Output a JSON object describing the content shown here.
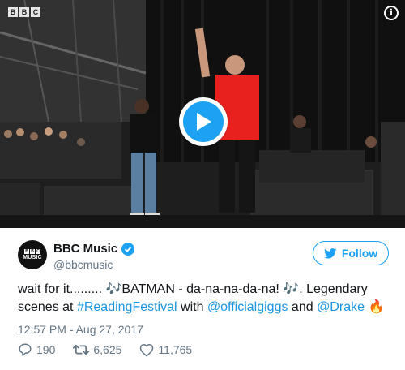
{
  "media": {
    "broadcaster_logo_letters": [
      "B",
      "B",
      "C"
    ],
    "info_label": "i"
  },
  "author": {
    "display_name": "BBC Music",
    "handle": "@bbcmusic",
    "avatar_letters": [
      "B",
      "B",
      "C"
    ],
    "avatar_word": "MUSIC",
    "verified": true
  },
  "follow_label": "Follow",
  "tweet": {
    "part1": "wait for it......... ",
    "notes1": "🎶",
    "part2": "BATMAN - da-na-na-da-na! ",
    "notes2": "🎶",
    "part3": ". Legendary scenes at ",
    "hashtag": "#ReadingFestival",
    "part4": " with ",
    "mention1": "@officialgiggs",
    "part5": " and ",
    "mention2": "@Drake",
    "part6": " ",
    "fire": "🔥"
  },
  "timestamp": "12:57 PM - Aug 27, 2017",
  "stats": {
    "replies": "190",
    "retweets": "6,625",
    "likes": "11,765"
  },
  "colors": {
    "accent": "#1da1f2",
    "link": "#1b95e0",
    "muted": "#657786",
    "shirt_red": "#e8201e"
  },
  "icons": [
    "play-icon",
    "info-icon",
    "verified-badge-icon",
    "twitter-bird-icon",
    "reply-icon",
    "retweet-icon",
    "like-icon"
  ]
}
